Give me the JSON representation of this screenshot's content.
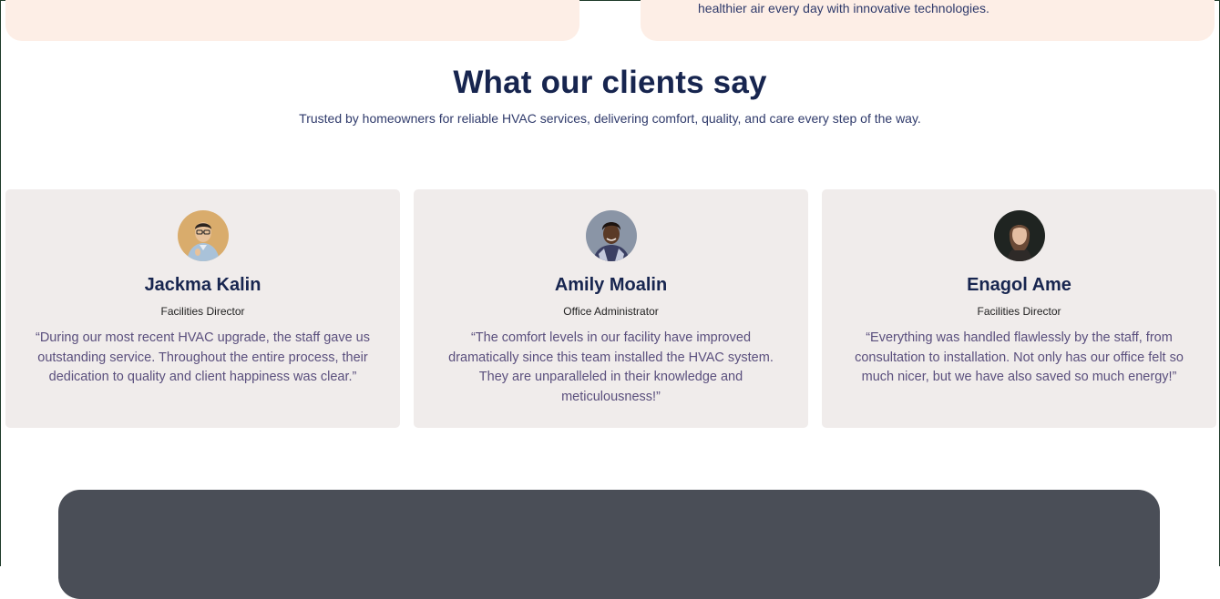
{
  "top_cards": {
    "right_text": "healthier air every day with innovative technologies."
  },
  "section": {
    "title": "What our clients say",
    "subtitle": "Trusted by homeowners for reliable HVAC services, delivering comfort, quality, and care every step of the way."
  },
  "testimonials": [
    {
      "name": "Jackma Kalin",
      "role": "Facilities Director",
      "quote": "“During our most recent HVAC upgrade, the staff gave us outstanding service. Throughout the entire process, their dedication to quality and client happiness was clear.”"
    },
    {
      "name": "Amily Moalin",
      "role": "Office Administrator",
      "quote": "“The comfort levels in our facility have improved dramatically since this team installed the HVAC system. They are unparalleled in their knowledge and meticulousness!”"
    },
    {
      "name": "Enagol Ame",
      "role": "Facilities Director",
      "quote": "“Everything was handled flawlessly by the staff, from consultation to installation. Not only has our office felt so much nicer, but we have also saved so much energy!”"
    }
  ],
  "colors": {
    "heading": "#17254f",
    "card_bg": "#f0eceb",
    "peach": "#fdeee6",
    "dark_panel": "#4a4e57"
  }
}
